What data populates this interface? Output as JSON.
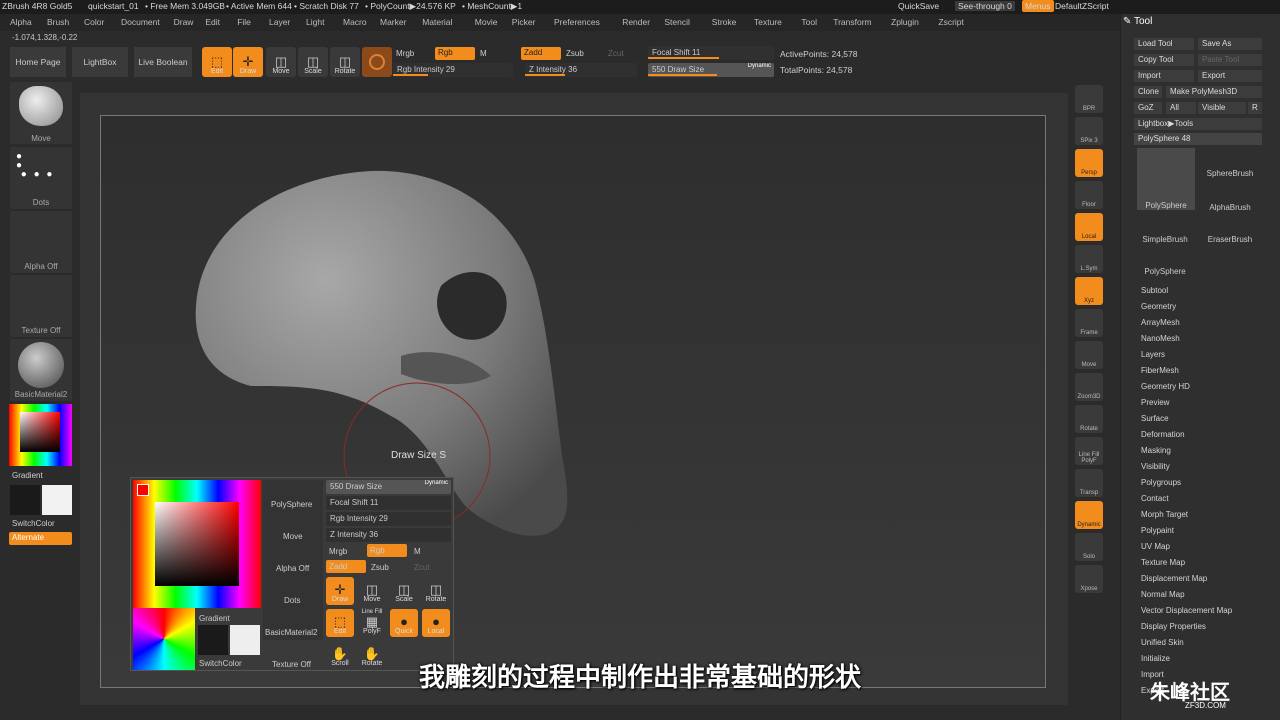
{
  "titlebar": {
    "app": "ZBrush 4R8 Gold5",
    "file": "quickstart_01",
    "free_mem": "• Free Mem 3.049GB",
    "active_mem": "• Active Mem 644",
    "scratch": "• Scratch Disk 77",
    "polycount": "• PolyCount▶24.576 KP",
    "meshcount": "• MeshCount▶1",
    "quicksave": "QuickSave",
    "seethrough": "See-through  0",
    "menus": "Menus",
    "script": "DefaultZScript"
  },
  "menu": [
    "Alpha",
    "Brush",
    "Color",
    "Document",
    "Draw",
    "Edit",
    "File",
    "Layer",
    "Light",
    "Macro",
    "Marker",
    "Material",
    "Movie",
    "Picker",
    "Preferences",
    "Render",
    "Stencil",
    "Stroke",
    "Texture",
    "Tool",
    "Transform",
    "Zplugin",
    "Zscript"
  ],
  "coords": "-1.074,1.328,-0.22",
  "top": {
    "home": "Home Page",
    "lightbox": "LightBox",
    "liveboolean": "Live Boolean",
    "edit": "Edit",
    "draw": "Draw",
    "move": "Move",
    "scale": "Scale",
    "rotate": "Rotate",
    "mrgb": "Mrgb",
    "rgb": "Rgb",
    "m": "M",
    "rgb_int": "Rgb Intensity 29",
    "zadd": "Zadd",
    "zsub": "Zsub",
    "zcut": "Zcut",
    "z_int": "Z Intensity 36",
    "focal": "Focal Shift 11",
    "drawsize": "550 Draw Size",
    "dynamic": "Dynamic",
    "active_points": "ActivePoints: 24,578",
    "total_points": "TotalPoints: 24,578",
    "rgb_int_level": 0.29,
    "z_int_level": 0.36,
    "focal_level": 0.56,
    "drawsize_level": 0.55
  },
  "left": {
    "move": "Move",
    "dots": "Dots",
    "alpha": "Alpha Off",
    "texture": "Texture Off",
    "material": "BasicMaterial2",
    "gradient": "Gradient",
    "switchcolor": "SwitchColor",
    "alternate": "Alternate"
  },
  "right_icons": [
    "BPR",
    "SPix 3",
    "Persp",
    "Floor",
    "Local",
    "L.Sym",
    "Xyz",
    "Frame",
    "Move",
    "Zoom3D",
    "Rotate",
    "Line Fill PolyF",
    "Transp",
    "Dynamic",
    "Solo",
    "Xpose"
  ],
  "tool": {
    "title": "Tool",
    "load": "Load Tool",
    "saveas": "Save As",
    "copy": "Copy Tool",
    "paste": "Paste Tool",
    "import": "Import",
    "export": "Export",
    "clone": "Clone",
    "make": "Make PolyMesh3D",
    "goz": "GoZ",
    "all": "All",
    "visible": "Visible",
    "r": "R",
    "lightbox": "Lightbox▶Tools",
    "polysphere": "PolySphere  48",
    "brushes": [
      "PolySphere",
      "SphereBrush",
      "AlphaBrush",
      "SimpleBrush",
      "EraserBrush",
      "PolySphere"
    ]
  },
  "tool_menu": [
    "Subtool",
    "Geometry",
    "ArrayMesh",
    "NanoMesh",
    "Layers",
    "FiberMesh",
    "Geometry HD",
    "Preview",
    "Surface",
    "Deformation",
    "Masking",
    "Visibility",
    "Polygroups",
    "Contact",
    "Morph Target",
    "Polypaint",
    "UV Map",
    "Texture Map",
    "Displacement Map",
    "Normal Map",
    "Vector Displacement Map",
    "Display Properties",
    "Unified Skin",
    "Initialize",
    "Import",
    "Export"
  ],
  "popup": {
    "drawsize": "550 Draw Size",
    "dynamic": "Dynamic",
    "focal": "Focal Shift 11",
    "rgb_int": "Rgb Intensity 29",
    "z_int": "Z Intensity 36",
    "mrgb": "Mrgb",
    "rgb": "Rgb",
    "m": "M",
    "zadd": "Zadd",
    "zsub": "Zsub",
    "zcut": "Zcut",
    "polysphere": "PolySphere",
    "move": "Move",
    "alpha": "Alpha Off",
    "dots": "Dots",
    "gradient": "Gradient",
    "material": "BasicMaterial2",
    "switchcolor": "SwitchColor",
    "texture": "Texture Off",
    "draw": "Draw",
    "pmove": "Move",
    "scale": "Scale",
    "rotate": "Rotate",
    "edit": "Edit",
    "linefill": "Line Fill",
    "polyf": "PolyF",
    "quick": "Quick",
    "local": "Local",
    "scroll": "Scroll",
    "protate": "Rotate"
  },
  "cursor_label": "Draw Size  S",
  "subtitle": "我雕刻的过程中制作出非常基础的形状",
  "watermark": "朱峰社区",
  "watermark_url": "ZF3D.COM"
}
